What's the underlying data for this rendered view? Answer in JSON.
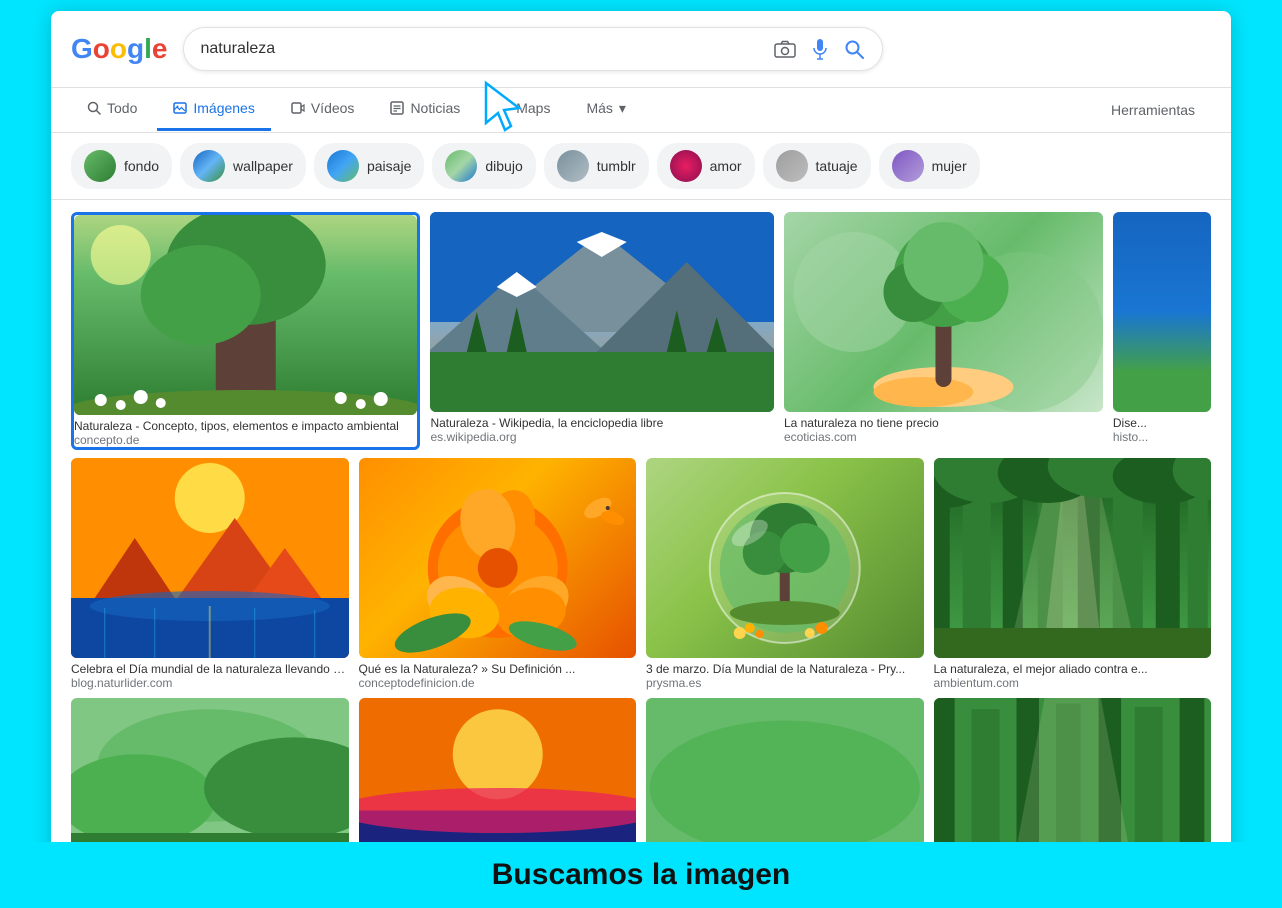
{
  "browser": {
    "background_color": "#00e5ff"
  },
  "header": {
    "logo": "Google",
    "logo_letters": [
      "G",
      "o",
      "o",
      "g",
      "l",
      "e"
    ],
    "logo_colors": [
      "#4285F4",
      "#EA4335",
      "#FBBC05",
      "#4285F4",
      "#34A853",
      "#EA4335"
    ],
    "search_value": "naturaleza",
    "search_placeholder": "naturaleza",
    "camera_icon": "📷",
    "mic_icon": "🎤",
    "search_icon": "🔍"
  },
  "nav": {
    "tabs": [
      {
        "label": "Todo",
        "icon": "🔍",
        "active": false
      },
      {
        "label": "Imágenes",
        "icon": "🖼",
        "active": true
      },
      {
        "label": "Vídeos",
        "icon": "▶",
        "active": false
      },
      {
        "label": "Noticias",
        "icon": "📰",
        "active": false
      },
      {
        "label": "Maps",
        "icon": "📍",
        "active": false
      },
      {
        "label": "Más",
        "icon": "⋮",
        "active": false
      }
    ],
    "tools_label": "Herramientas"
  },
  "chips": [
    {
      "label": "fondo",
      "color_class": "chip-fondo"
    },
    {
      "label": "wallpaper",
      "color_class": "chip-wallpaper"
    },
    {
      "label": "paisaje",
      "color_class": "chip-paisaje"
    },
    {
      "label": "dibujo",
      "color_class": "chip-dibujo"
    },
    {
      "label": "tumblr",
      "color_class": "chip-tumblr"
    },
    {
      "label": "amor",
      "color_class": "chip-amor"
    },
    {
      "label": "tatuaje",
      "color_class": "chip-tatuaje"
    },
    {
      "label": "mujer",
      "color_class": "chip-mujer"
    }
  ],
  "image_row1": [
    {
      "caption": "Naturaleza - Concepto, tipos, elementos e impacto ambiental",
      "source": "concepto.de",
      "color_class": "nature-green",
      "selected": true,
      "height": "tall"
    },
    {
      "caption": "Naturaleza - Wikipedia, la enciclopedia libre",
      "source": "es.wikipedia.org",
      "color_class": "nature-mountain",
      "selected": false,
      "height": "tall"
    },
    {
      "caption": "La naturaleza no tiene precio",
      "source": "ecoticias.com",
      "color_class": "nature-tree",
      "selected": false,
      "height": "tall"
    },
    {
      "caption": "Dise...",
      "source": "histo...",
      "color_class": "nature-partial",
      "selected": false,
      "height": "tall",
      "partial": true
    }
  ],
  "image_row2": [
    {
      "caption": "Celebra el Día mundial de la naturaleza llevando u...",
      "source": "blog.naturlider.com",
      "color_class": "nature-lake",
      "selected": false,
      "height": "medium"
    },
    {
      "caption": "Qué es la Naturaleza? » Su Definición ...",
      "source": "conceptodefinicion.de",
      "color_class": "nature-flower",
      "selected": false,
      "height": "medium"
    },
    {
      "caption": "3 de marzo. Día Mundial de la Naturaleza - Pry...",
      "source": "prysma.es",
      "color_class": "nature-globe",
      "selected": false,
      "height": "medium"
    },
    {
      "caption": "La naturaleza, el mejor aliado contra e...",
      "source": "ambientum.com",
      "color_class": "nature-forest",
      "selected": false,
      "height": "medium"
    }
  ],
  "image_row3": [
    {
      "color_class": "nature-green",
      "height": "short"
    },
    {
      "color_class": "nature-sunset",
      "height": "short"
    },
    {
      "color_class": "nature-forest2",
      "height": "short"
    },
    {
      "color_class": "nature-forest3",
      "height": "short"
    }
  ],
  "bottom_caption": "Buscamos la imagen"
}
